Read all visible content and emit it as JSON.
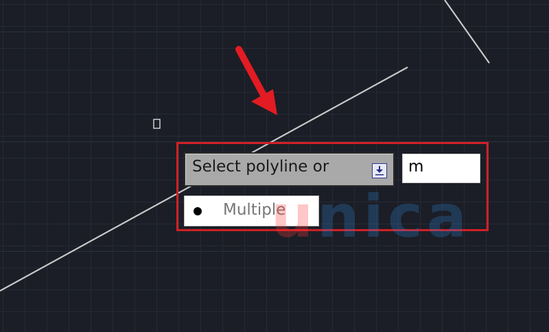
{
  "command_prompt": {
    "text": "Select polyline or",
    "dropdown_icon": "dropdown-arrow-icon"
  },
  "command_input": {
    "value": "m"
  },
  "option_list": {
    "items": [
      {
        "label": "Multiple",
        "bullet_icon": "bullet-icon"
      }
    ]
  },
  "annotations": {
    "arrow_color": "#e31b23",
    "frame_color": "#d21f26"
  },
  "watermark": {
    "first_letter": "u",
    "rest": "nica"
  },
  "colors": {
    "canvas_background": "#1b1e26",
    "grid_line": "#262a35",
    "prompt_background": "#a9a9a9"
  }
}
